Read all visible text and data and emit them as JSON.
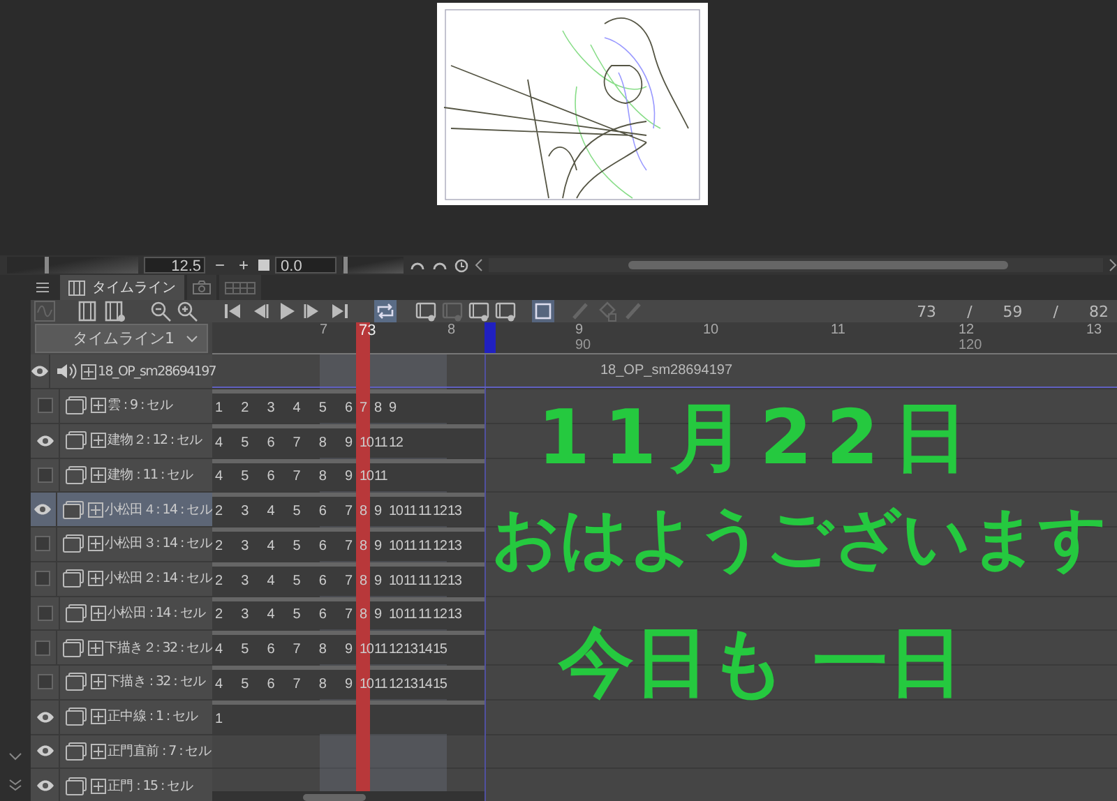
{
  "navigator": {
    "zoom_slider": {
      "level": 0.3
    },
    "zoom": "12.5",
    "zoom_out": "−",
    "zoom_in": "+",
    "angle": "0.0",
    "rotation_slider": {
      "level": 0.02
    }
  },
  "panel_tabs": [
    {
      "kind": "timeline",
      "label": "タイムライン",
      "selected": true
    },
    {
      "kind": "camera",
      "selected": false
    },
    {
      "kind": "grid",
      "selected": false
    }
  ],
  "frame_readout": [
    "73",
    "/",
    "59",
    "/",
    "82"
  ],
  "timeline_select": "タイムライン1",
  "ruler": {
    "current": "73",
    "seconds": [
      {
        "label": "7"
      },
      {
        "label": "8"
      },
      {
        "label": "9",
        "frame": "90"
      },
      {
        "label": "10"
      },
      {
        "label": "11"
      },
      {
        "label": "12",
        "frame": "120"
      },
      {
        "label": "13"
      }
    ]
  },
  "audio_track": {
    "visible": true,
    "name": "18_OP_sm28694197",
    "clip": "18_OP_sm28694197"
  },
  "layers": [
    {
      "name": "雲 : 9 : セル",
      "visible": false,
      "selected": false,
      "frames": [
        "1",
        "2",
        "3",
        "4",
        "5",
        "6",
        "7",
        "8",
        "9"
      ]
    },
    {
      "name": "建物２: 12 : セル",
      "visible": true,
      "selected": false,
      "frames": [
        "4",
        "5",
        "6",
        "7",
        "8",
        "9",
        "10",
        "11",
        "12"
      ]
    },
    {
      "name": "建物 : 11 : セル",
      "visible": false,
      "selected": false,
      "frames": [
        "4",
        "5",
        "6",
        "7",
        "8",
        "9",
        "10",
        "11"
      ]
    },
    {
      "name": "小松田４: 14 : セル",
      "visible": true,
      "selected": true,
      "frames": [
        "2",
        "3",
        "4",
        "5",
        "6",
        "7",
        "8",
        "9",
        "10",
        "11",
        "11",
        "12",
        "13"
      ]
    },
    {
      "name": "小松田３: 14 : セル",
      "visible": false,
      "selected": false,
      "frames": [
        "2",
        "3",
        "4",
        "5",
        "6",
        "7",
        "8",
        "9",
        "10",
        "11",
        "11",
        "12",
        "13"
      ]
    },
    {
      "name": "小松田２: 14 : セル",
      "visible": false,
      "selected": false,
      "frames": [
        "2",
        "3",
        "4",
        "5",
        "6",
        "7",
        "8",
        "9",
        "10",
        "11",
        "11",
        "12",
        "13"
      ]
    },
    {
      "name": "小松田 : 14 : セル",
      "visible": false,
      "selected": false,
      "frames": [
        "2",
        "3",
        "4",
        "5",
        "6",
        "7",
        "8",
        "9",
        "10",
        "11",
        "11",
        "12",
        "13"
      ]
    },
    {
      "name": "下描き２: 32 : セル",
      "visible": false,
      "selected": false,
      "frames": [
        "4",
        "5",
        "6",
        "7",
        "8",
        "9",
        "10",
        "11",
        "12",
        "13",
        "14",
        "15"
      ]
    },
    {
      "name": "下描き : 32 : セル",
      "visible": false,
      "selected": false,
      "frames": [
        "4",
        "5",
        "6",
        "7",
        "8",
        "9",
        "10",
        "11",
        "12",
        "13",
        "14",
        "15"
      ]
    },
    {
      "name": "正中線 : 1 : セル",
      "visible": true,
      "selected": false,
      "frames": [
        "1"
      ]
    },
    {
      "name": "正門直前 : 7 : セル",
      "visible": true,
      "selected": false
    },
    {
      "name": "正門 : 15 : セル",
      "visible": true,
      "selected": false
    }
  ],
  "handwriting": [
    "11月22日",
    "おはようございます",
    "今日も 一日"
  ]
}
